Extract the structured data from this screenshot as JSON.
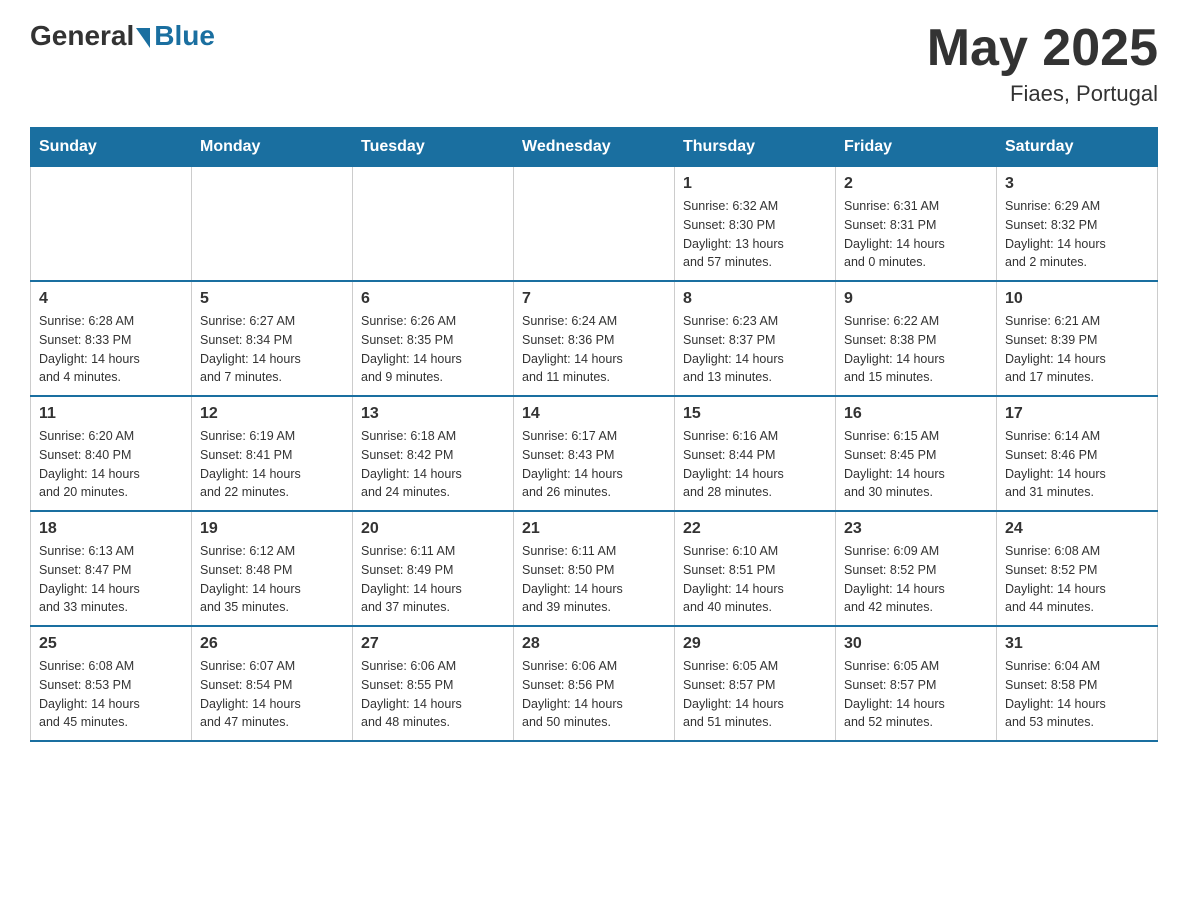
{
  "header": {
    "logo_general": "General",
    "logo_blue": "Blue",
    "month_title": "May 2025",
    "location": "Fiaes, Portugal"
  },
  "weekdays": [
    "Sunday",
    "Monday",
    "Tuesday",
    "Wednesday",
    "Thursday",
    "Friday",
    "Saturday"
  ],
  "weeks": [
    [
      {
        "day": "",
        "info": ""
      },
      {
        "day": "",
        "info": ""
      },
      {
        "day": "",
        "info": ""
      },
      {
        "day": "",
        "info": ""
      },
      {
        "day": "1",
        "info": "Sunrise: 6:32 AM\nSunset: 8:30 PM\nDaylight: 13 hours\nand 57 minutes."
      },
      {
        "day": "2",
        "info": "Sunrise: 6:31 AM\nSunset: 8:31 PM\nDaylight: 14 hours\nand 0 minutes."
      },
      {
        "day": "3",
        "info": "Sunrise: 6:29 AM\nSunset: 8:32 PM\nDaylight: 14 hours\nand 2 minutes."
      }
    ],
    [
      {
        "day": "4",
        "info": "Sunrise: 6:28 AM\nSunset: 8:33 PM\nDaylight: 14 hours\nand 4 minutes."
      },
      {
        "day": "5",
        "info": "Sunrise: 6:27 AM\nSunset: 8:34 PM\nDaylight: 14 hours\nand 7 minutes."
      },
      {
        "day": "6",
        "info": "Sunrise: 6:26 AM\nSunset: 8:35 PM\nDaylight: 14 hours\nand 9 minutes."
      },
      {
        "day": "7",
        "info": "Sunrise: 6:24 AM\nSunset: 8:36 PM\nDaylight: 14 hours\nand 11 minutes."
      },
      {
        "day": "8",
        "info": "Sunrise: 6:23 AM\nSunset: 8:37 PM\nDaylight: 14 hours\nand 13 minutes."
      },
      {
        "day": "9",
        "info": "Sunrise: 6:22 AM\nSunset: 8:38 PM\nDaylight: 14 hours\nand 15 minutes."
      },
      {
        "day": "10",
        "info": "Sunrise: 6:21 AM\nSunset: 8:39 PM\nDaylight: 14 hours\nand 17 minutes."
      }
    ],
    [
      {
        "day": "11",
        "info": "Sunrise: 6:20 AM\nSunset: 8:40 PM\nDaylight: 14 hours\nand 20 minutes."
      },
      {
        "day": "12",
        "info": "Sunrise: 6:19 AM\nSunset: 8:41 PM\nDaylight: 14 hours\nand 22 minutes."
      },
      {
        "day": "13",
        "info": "Sunrise: 6:18 AM\nSunset: 8:42 PM\nDaylight: 14 hours\nand 24 minutes."
      },
      {
        "day": "14",
        "info": "Sunrise: 6:17 AM\nSunset: 8:43 PM\nDaylight: 14 hours\nand 26 minutes."
      },
      {
        "day": "15",
        "info": "Sunrise: 6:16 AM\nSunset: 8:44 PM\nDaylight: 14 hours\nand 28 minutes."
      },
      {
        "day": "16",
        "info": "Sunrise: 6:15 AM\nSunset: 8:45 PM\nDaylight: 14 hours\nand 30 minutes."
      },
      {
        "day": "17",
        "info": "Sunrise: 6:14 AM\nSunset: 8:46 PM\nDaylight: 14 hours\nand 31 minutes."
      }
    ],
    [
      {
        "day": "18",
        "info": "Sunrise: 6:13 AM\nSunset: 8:47 PM\nDaylight: 14 hours\nand 33 minutes."
      },
      {
        "day": "19",
        "info": "Sunrise: 6:12 AM\nSunset: 8:48 PM\nDaylight: 14 hours\nand 35 minutes."
      },
      {
        "day": "20",
        "info": "Sunrise: 6:11 AM\nSunset: 8:49 PM\nDaylight: 14 hours\nand 37 minutes."
      },
      {
        "day": "21",
        "info": "Sunrise: 6:11 AM\nSunset: 8:50 PM\nDaylight: 14 hours\nand 39 minutes."
      },
      {
        "day": "22",
        "info": "Sunrise: 6:10 AM\nSunset: 8:51 PM\nDaylight: 14 hours\nand 40 minutes."
      },
      {
        "day": "23",
        "info": "Sunrise: 6:09 AM\nSunset: 8:52 PM\nDaylight: 14 hours\nand 42 minutes."
      },
      {
        "day": "24",
        "info": "Sunrise: 6:08 AM\nSunset: 8:52 PM\nDaylight: 14 hours\nand 44 minutes."
      }
    ],
    [
      {
        "day": "25",
        "info": "Sunrise: 6:08 AM\nSunset: 8:53 PM\nDaylight: 14 hours\nand 45 minutes."
      },
      {
        "day": "26",
        "info": "Sunrise: 6:07 AM\nSunset: 8:54 PM\nDaylight: 14 hours\nand 47 minutes."
      },
      {
        "day": "27",
        "info": "Sunrise: 6:06 AM\nSunset: 8:55 PM\nDaylight: 14 hours\nand 48 minutes."
      },
      {
        "day": "28",
        "info": "Sunrise: 6:06 AM\nSunset: 8:56 PM\nDaylight: 14 hours\nand 50 minutes."
      },
      {
        "day": "29",
        "info": "Sunrise: 6:05 AM\nSunset: 8:57 PM\nDaylight: 14 hours\nand 51 minutes."
      },
      {
        "day": "30",
        "info": "Sunrise: 6:05 AM\nSunset: 8:57 PM\nDaylight: 14 hours\nand 52 minutes."
      },
      {
        "day": "31",
        "info": "Sunrise: 6:04 AM\nSunset: 8:58 PM\nDaylight: 14 hours\nand 53 minutes."
      }
    ]
  ]
}
